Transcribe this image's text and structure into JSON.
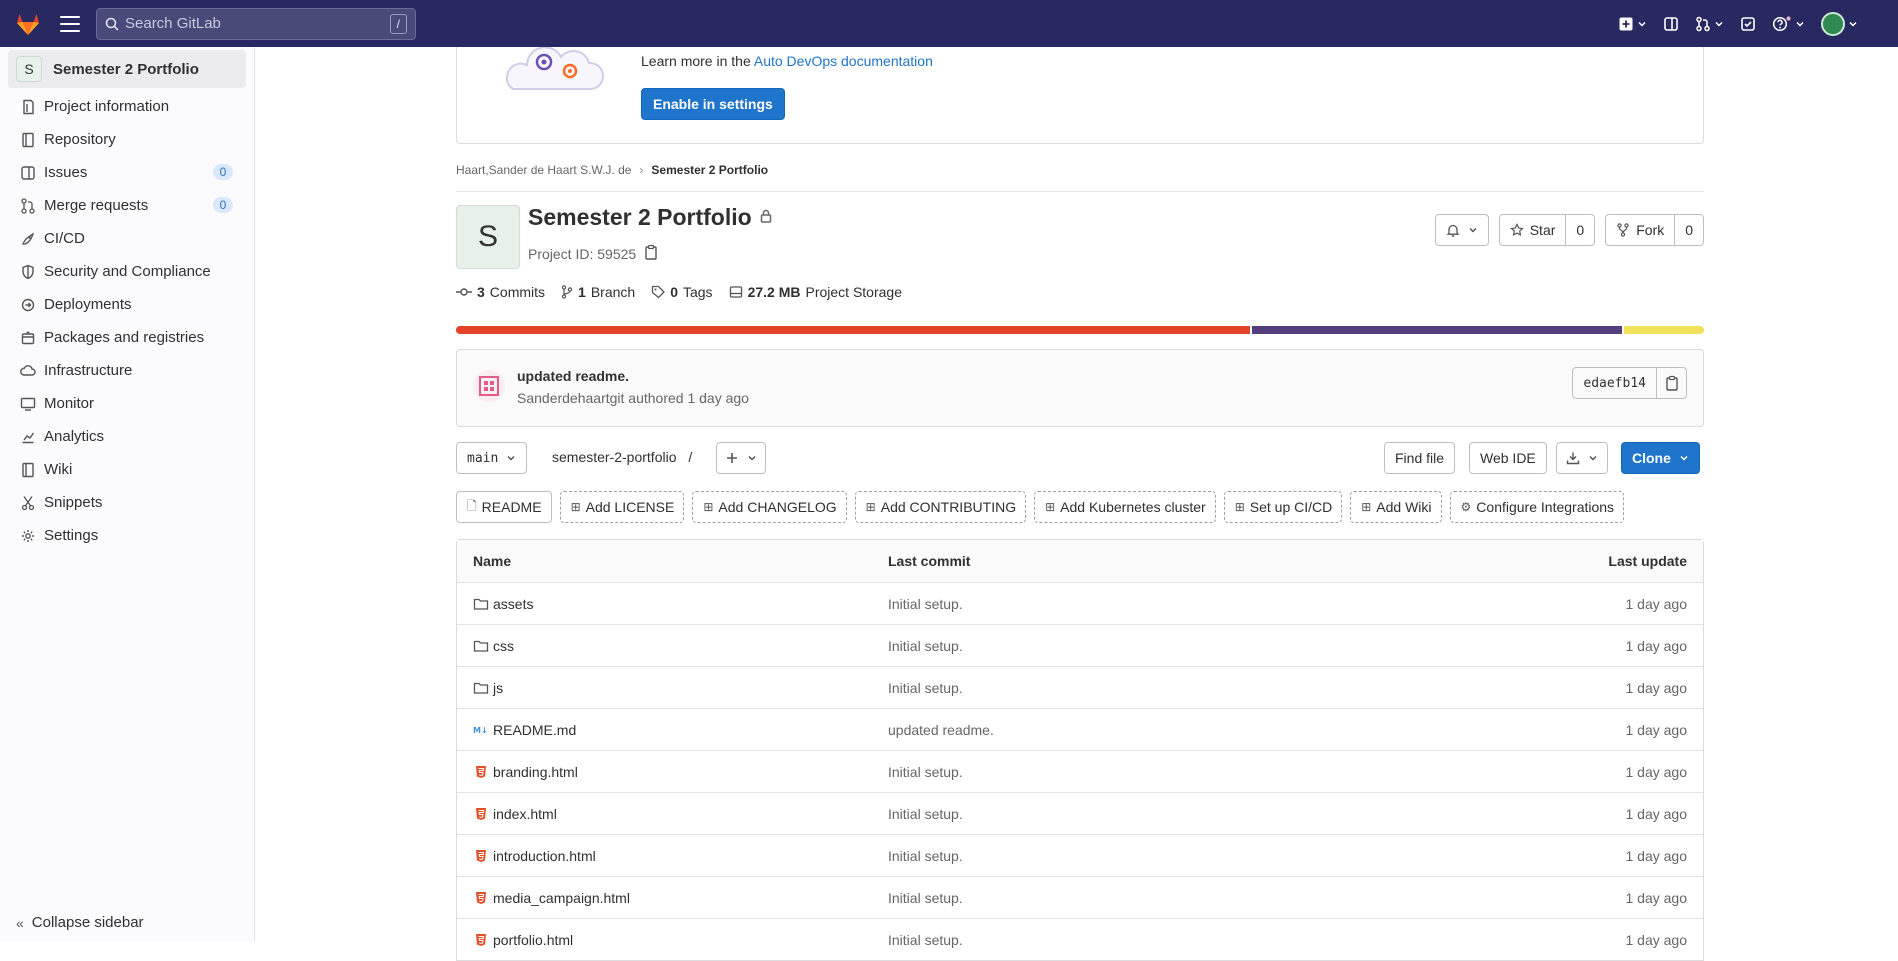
{
  "topbar": {
    "search_placeholder": "Search GitLab",
    "search_shortcut": "/"
  },
  "sidebar": {
    "project_initial": "S",
    "project_name": "Semester 2 Portfolio",
    "items": [
      {
        "label": "Project information",
        "icon": "info-icon"
      },
      {
        "label": "Repository",
        "icon": "book-icon"
      },
      {
        "label": "Issues",
        "icon": "issues-icon",
        "count": "0"
      },
      {
        "label": "Merge requests",
        "icon": "merge-request-icon",
        "count": "0"
      },
      {
        "label": "CI/CD",
        "icon": "rocket-icon"
      },
      {
        "label": "Security and Compliance",
        "icon": "shield-icon"
      },
      {
        "label": "Deployments",
        "icon": "deployments-icon"
      },
      {
        "label": "Packages and registries",
        "icon": "package-icon"
      },
      {
        "label": "Infrastructure",
        "icon": "cloud-icon"
      },
      {
        "label": "Monitor",
        "icon": "monitor-icon"
      },
      {
        "label": "Analytics",
        "icon": "chart-icon"
      },
      {
        "label": "Wiki",
        "icon": "book-icon"
      },
      {
        "label": "Snippets",
        "icon": "scissors-icon"
      },
      {
        "label": "Settings",
        "icon": "gear-icon"
      }
    ],
    "collapse_label": "Collapse sidebar"
  },
  "banner": {
    "text": "Learn more in the ",
    "link": "Auto DevOps documentation",
    "button": "Enable in settings"
  },
  "breadcrumb": {
    "parent": "Haart,Sander de Haart S.W.J. de",
    "current": "Semester 2 Portfolio"
  },
  "project": {
    "initial": "S",
    "title": "Semester 2 Portfolio",
    "id_label": "Project ID: 59525",
    "star_label": "Star",
    "star_count": "0",
    "fork_label": "Fork",
    "fork_count": "0"
  },
  "stats": {
    "commits_n": "3",
    "commits_label": "Commits",
    "branches_n": "1",
    "branches_label": "Branch",
    "tags_n": "0",
    "tags_label": "Tags",
    "storage_n": "27.2 MB",
    "storage_label": "Project Storage"
  },
  "languages": [
    {
      "color": "#e24329",
      "share": 0.638
    },
    {
      "color": "#563d7c",
      "share": 0.298
    },
    {
      "color": "#f1e05a",
      "share": 0.064
    }
  ],
  "commit": {
    "message": "updated readme.",
    "meta": "Sanderdehaartgit authored 1 day ago",
    "sha": "edaefb14"
  },
  "tree": {
    "branch": "main",
    "path": "semester-2-portfolio",
    "path_sep": "/",
    "find_file": "Find file",
    "web_ide": "Web IDE",
    "clone": "Clone"
  },
  "shortcuts": [
    {
      "label": "README",
      "style": "solid",
      "icon": "file-icon"
    },
    {
      "label": "Add LICENSE",
      "icon": "plus-square-icon"
    },
    {
      "label": "Add CHANGELOG",
      "icon": "plus-square-icon"
    },
    {
      "label": "Add CONTRIBUTING",
      "icon": "plus-square-icon"
    },
    {
      "label": "Add Kubernetes cluster",
      "icon": "plus-square-icon"
    },
    {
      "label": "Set up CI/CD",
      "icon": "plus-square-icon"
    },
    {
      "label": "Add Wiki",
      "icon": "plus-square-icon"
    },
    {
      "label": "Configure Integrations",
      "icon": "gear-icon"
    }
  ],
  "files": {
    "headers": {
      "name": "Name",
      "commit": "Last commit",
      "updated": "Last update"
    },
    "rows": [
      {
        "name": "assets",
        "type": "folder",
        "commit": "Initial setup.",
        "updated": "1 day ago"
      },
      {
        "name": "css",
        "type": "folder",
        "commit": "Initial setup.",
        "updated": "1 day ago"
      },
      {
        "name": "js",
        "type": "folder",
        "commit": "Initial setup.",
        "updated": "1 day ago"
      },
      {
        "name": "README.md",
        "type": "markdown",
        "commit": "updated readme.",
        "updated": "1 day ago"
      },
      {
        "name": "branding.html",
        "type": "html",
        "commit": "Initial setup.",
        "updated": "1 day ago"
      },
      {
        "name": "index.html",
        "type": "html",
        "commit": "Initial setup.",
        "updated": "1 day ago"
      },
      {
        "name": "introduction.html",
        "type": "html",
        "commit": "Initial setup.",
        "updated": "1 day ago"
      },
      {
        "name": "media_campaign.html",
        "type": "html",
        "commit": "Initial setup.",
        "updated": "1 day ago"
      },
      {
        "name": "portfolio.html",
        "type": "html",
        "commit": "Initial setup.",
        "updated": "1 day ago"
      }
    ]
  }
}
